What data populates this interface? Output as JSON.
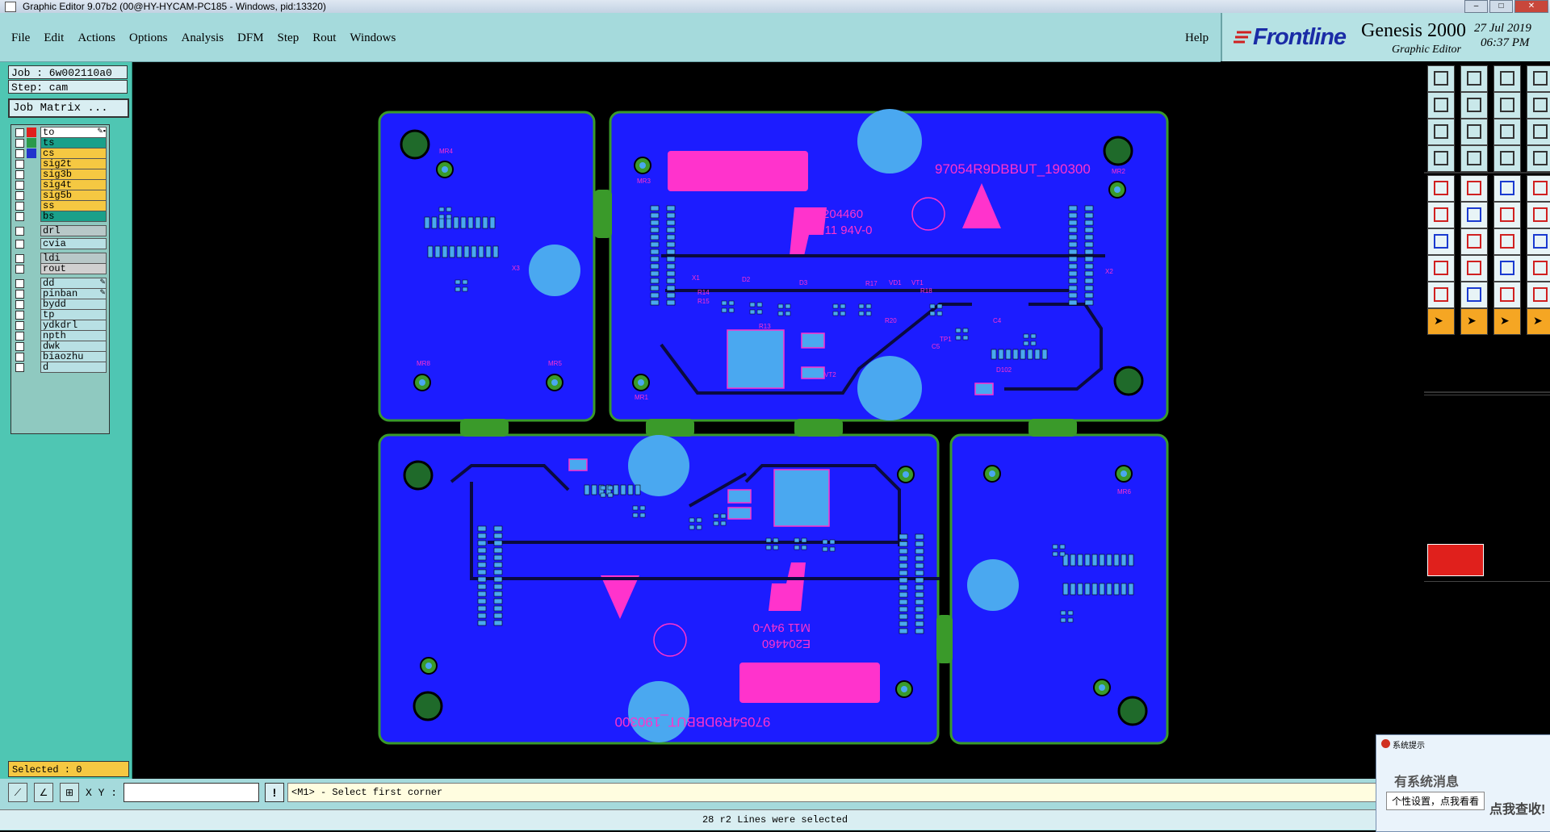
{
  "window": {
    "title": "Graphic Editor 9.07b2 (00@HY-HYCAM-PC185 - Windows, pid:13320)"
  },
  "menu": {
    "items": [
      "File",
      "Edit",
      "Actions",
      "Options",
      "Analysis",
      "DFM",
      "Step",
      "Rout",
      "Windows"
    ],
    "help": "Help"
  },
  "brand": {
    "logo": "Frontline",
    "product": "Genesis 2000",
    "subtitle": "Graphic Editor",
    "date": "27 Jul 2019",
    "time": "06:37 PM"
  },
  "left": {
    "job": "Job : 6w002110a0",
    "step": "Step: cam",
    "matrix_button": "Job Matrix ...",
    "selected": "Selected : 0"
  },
  "layers": [
    {
      "name": "to",
      "color": "#ffffff",
      "swatch": "#e0201c",
      "mark": "✎▪"
    },
    {
      "name": "ts",
      "color": "#1aa08a",
      "swatch": "#2a9a4a",
      "mark": ""
    },
    {
      "name": "cs",
      "color": "#f5c842",
      "swatch": "#2233cc",
      "mark": ""
    },
    {
      "name": "sig2t",
      "color": "#f5c842",
      "swatch": "",
      "mark": ""
    },
    {
      "name": "sig3b",
      "color": "#f5c842",
      "swatch": "",
      "mark": ""
    },
    {
      "name": "sig4t",
      "color": "#f5c842",
      "swatch": "",
      "mark": ""
    },
    {
      "name": "sig5b",
      "color": "#f5c842",
      "swatch": "",
      "mark": ""
    },
    {
      "name": "ss",
      "color": "#f5c842",
      "swatch": "",
      "mark": ""
    },
    {
      "name": "bs",
      "color": "#1aa08a",
      "swatch": "",
      "mark": ""
    },
    {
      "name": "drl",
      "color": "#b8c8c8",
      "swatch": "",
      "mark": ""
    },
    {
      "name": "cvia",
      "color": "#b8e0e4",
      "swatch": "",
      "mark": ""
    },
    {
      "name": "ldi",
      "color": "#b8c8c8",
      "swatch": "",
      "mark": ""
    },
    {
      "name": "rout",
      "color": "#d0d0d0",
      "swatch": "",
      "mark": ""
    },
    {
      "name": "dd",
      "color": "#b8e0e4",
      "swatch": "",
      "mark": "✎"
    },
    {
      "name": "pinban",
      "color": "#b8e0e4",
      "swatch": "",
      "mark": "✎"
    },
    {
      "name": "bydd",
      "color": "#b8e0e4",
      "swatch": "",
      "mark": ""
    },
    {
      "name": "tp",
      "color": "#b8e0e4",
      "swatch": "",
      "mark": ""
    },
    {
      "name": "ydkdrl",
      "color": "#b8e0e4",
      "swatch": "",
      "mark": ""
    },
    {
      "name": "npth",
      "color": "#b8e0e4",
      "swatch": "",
      "mark": ""
    },
    {
      "name": "dwk",
      "color": "#b8e0e4",
      "swatch": "",
      "mark": ""
    },
    {
      "name": "biaozhu",
      "color": "#b8e0e4",
      "swatch": "",
      "mark": ""
    },
    {
      "name": "d",
      "color": "#b8e0e4",
      "swatch": "",
      "mark": ""
    }
  ],
  "board": {
    "marking_top": "97054R9DBBUT_190300",
    "marking_bottom": "97054R9DBBUT_190300",
    "ul_code": "E204460",
    "ul_rating": "M11 94V-0",
    "refs": [
      "MR4",
      "MR3",
      "MR2",
      "MR1",
      "MR8",
      "MR5",
      "MR6",
      "X1",
      "X2",
      "X3",
      "D2",
      "D3",
      "VD1",
      "VT1",
      "VT2",
      "R13",
      "R14",
      "R15",
      "R17",
      "R18",
      "R20",
      "TP1",
      "D102",
      "C4",
      "C5"
    ]
  },
  "bottom": {
    "xy_label": "X Y :",
    "xy_value": "",
    "warn": "!",
    "prompt": "<M1> - Select first corner",
    "status": "28 r2 Lines were selected"
  },
  "notification": {
    "title": "系统提示",
    "headline": "有系统消息",
    "tooltip": "个性设置，点我看看",
    "tail": "点我查收!"
  },
  "colors": {
    "board_blue": "#1c1cff",
    "pad_light": "#4aa8f0",
    "silk_magenta": "#ff33cc",
    "outline_green": "#3a9a2a",
    "trace_black": "#0a0a40"
  }
}
